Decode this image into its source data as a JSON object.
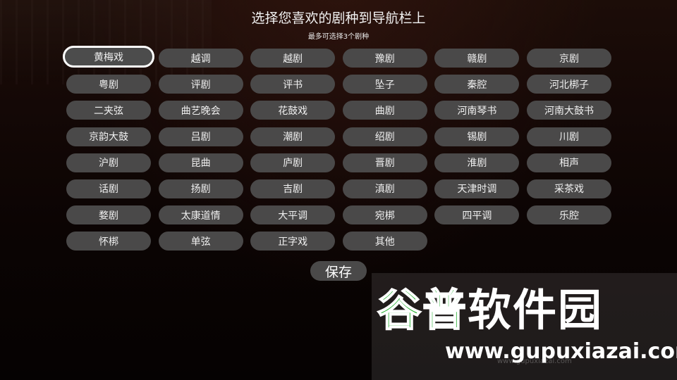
{
  "header": {
    "title": "选择您喜欢的剧种到导航栏上",
    "subtitle": "最多可选择3个剧种"
  },
  "genres": [
    {
      "label": "黄梅戏",
      "selected": true
    },
    {
      "label": "越调",
      "selected": false
    },
    {
      "label": "越剧",
      "selected": false
    },
    {
      "label": "豫剧",
      "selected": false
    },
    {
      "label": "赣剧",
      "selected": false
    },
    {
      "label": "京剧",
      "selected": false
    },
    {
      "label": "粤剧",
      "selected": false
    },
    {
      "label": "评剧",
      "selected": false
    },
    {
      "label": "评书",
      "selected": false
    },
    {
      "label": "坠子",
      "selected": false
    },
    {
      "label": "秦腔",
      "selected": false
    },
    {
      "label": "河北梆子",
      "selected": false
    },
    {
      "label": "二夹弦",
      "selected": false
    },
    {
      "label": "曲艺晚会",
      "selected": false
    },
    {
      "label": "花鼓戏",
      "selected": false
    },
    {
      "label": "曲剧",
      "selected": false
    },
    {
      "label": "河南琴书",
      "selected": false
    },
    {
      "label": "河南大鼓书",
      "selected": false
    },
    {
      "label": "京韵大鼓",
      "selected": false
    },
    {
      "label": "吕剧",
      "selected": false
    },
    {
      "label": "潮剧",
      "selected": false
    },
    {
      "label": "绍剧",
      "selected": false
    },
    {
      "label": "锡剧",
      "selected": false
    },
    {
      "label": "川剧",
      "selected": false
    },
    {
      "label": "沪剧",
      "selected": false
    },
    {
      "label": "昆曲",
      "selected": false
    },
    {
      "label": "庐剧",
      "selected": false
    },
    {
      "label": "晋剧",
      "selected": false
    },
    {
      "label": "淮剧",
      "selected": false
    },
    {
      "label": "相声",
      "selected": false
    },
    {
      "label": "话剧",
      "selected": false
    },
    {
      "label": "扬剧",
      "selected": false
    },
    {
      "label": "吉剧",
      "selected": false
    },
    {
      "label": "滇剧",
      "selected": false
    },
    {
      "label": "天津时调",
      "selected": false
    },
    {
      "label": "采茶戏",
      "selected": false
    },
    {
      "label": "婺剧",
      "selected": false
    },
    {
      "label": "太康道情",
      "selected": false
    },
    {
      "label": "大平调",
      "selected": false
    },
    {
      "label": "宛梆",
      "selected": false
    },
    {
      "label": "四平调",
      "selected": false
    },
    {
      "label": "乐腔",
      "selected": false
    },
    {
      "label": "怀梆",
      "selected": false
    },
    {
      "label": "单弦",
      "selected": false
    },
    {
      "label": "正字戏",
      "selected": false
    },
    {
      "label": "其他",
      "selected": false
    }
  ],
  "actions": {
    "save_label": "保存"
  },
  "watermark": {
    "name_part1": "谷普",
    "name_part2": "软件园",
    "url": "www.gupuxiazai.com",
    "faint_text": "www.gupuxiazai.com"
  },
  "colors": {
    "chip_bg": "#4a4949",
    "selected_border": "#ffffff",
    "watermark_green": "#1fae2a"
  }
}
